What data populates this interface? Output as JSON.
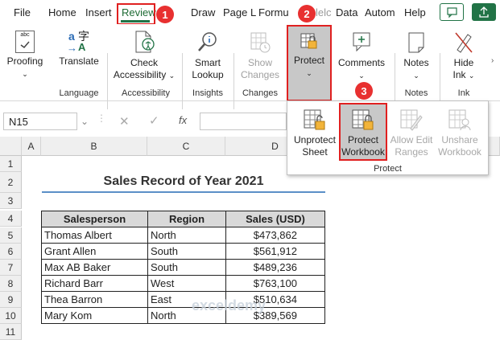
{
  "tabs": [
    "File",
    "Home",
    "Insert",
    "Review",
    "Draw",
    "Page L",
    "Formu",
    "lelc",
    "Data",
    "Autom",
    "Help"
  ],
  "ribbon": {
    "proofing": "Proofing",
    "translate": "Translate",
    "language": "Language",
    "check_line1": "Check",
    "check_line2": "Accessibility",
    "accessibility": "Accessibility",
    "smart_line1": "Smart",
    "smart_line2": "Lookup",
    "insights": "Insights",
    "show_line1": "Show",
    "show_line2": "Changes",
    "changes": "Changes",
    "protect": "Protect",
    "comments": "Comments",
    "notes": "Notes",
    "notes_group": "Notes",
    "hide_line1": "Hide",
    "hide_line2": "Ink",
    "ink": "Ink"
  },
  "formula": {
    "namebox": "N15",
    "fx": "fx"
  },
  "flyout": {
    "unprotect1": "Unprotect",
    "unprotect2": "Sheet",
    "protectwb1": "Protect",
    "protectwb2": "Workbook",
    "allow1": "Allow Edit",
    "allow2": "Ranges",
    "unshare1": "Unshare",
    "unshare2": "Workbook",
    "group": "Protect"
  },
  "badges": [
    "1",
    "2",
    "3"
  ],
  "columns": [
    "A",
    "B",
    "C",
    "D"
  ],
  "rows": [
    "1",
    "2",
    "3",
    "4",
    "5",
    "6",
    "7",
    "8",
    "9",
    "10",
    "11"
  ],
  "sheet": {
    "title": "Sales Record of Year 2021",
    "headers": [
      "Salesperson",
      "Region",
      "Sales (USD)"
    ],
    "data": [
      [
        "Thomas Albert",
        "North",
        "$473,862"
      ],
      [
        "Grant Allen",
        "South",
        "$561,912"
      ],
      [
        "Max AB Baker",
        "South",
        "$489,236"
      ],
      [
        "Richard Barr",
        "West",
        "$763,100"
      ],
      [
        "Thea Barron",
        "East",
        "$510,634"
      ],
      [
        "Mary Kom",
        "North",
        "$389,569"
      ]
    ]
  },
  "watermark": "exceldemy",
  "colors": {
    "accent": "#217346",
    "badge": "#e83030",
    "highlight": "#e02020"
  }
}
